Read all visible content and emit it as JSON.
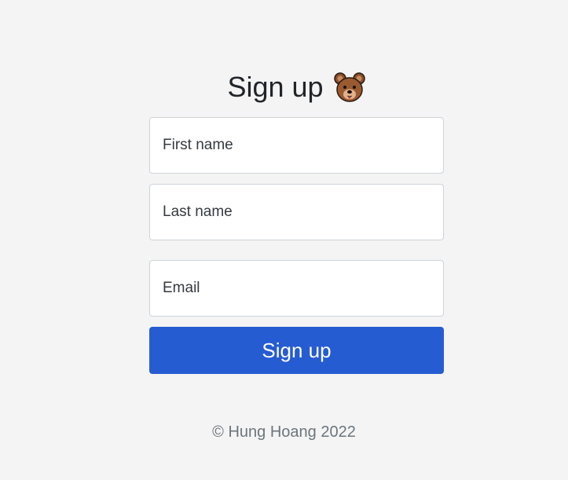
{
  "form": {
    "title": "Sign up",
    "title_icon": "bear-face-icon",
    "fields": [
      {
        "name": "first_name",
        "placeholder": "First name",
        "value": ""
      },
      {
        "name": "last_name",
        "placeholder": "Last name",
        "value": ""
      },
      {
        "name": "email",
        "placeholder": "Email",
        "value": ""
      }
    ],
    "submit_label": "Sign up"
  },
  "footer": {
    "text": "© Hung Hoang 2022"
  },
  "colors": {
    "background": "#f4f4f4",
    "accent": "#265cd2",
    "muted_text": "#6c757d"
  }
}
